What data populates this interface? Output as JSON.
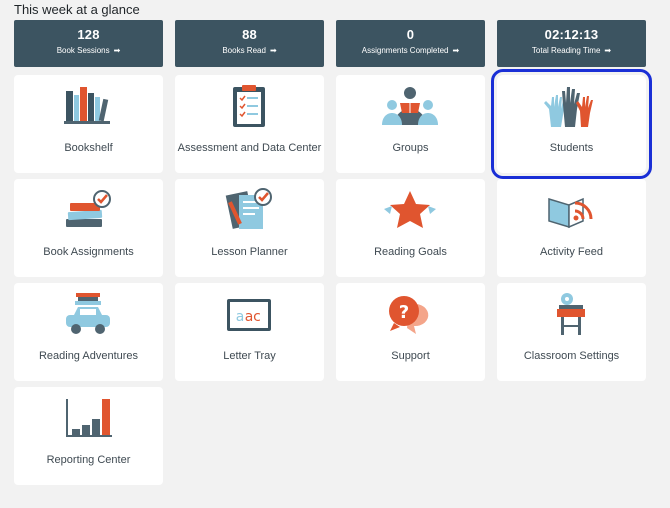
{
  "heading": "This week at a glance",
  "stats": [
    {
      "value": "128",
      "label": "Book Sessions",
      "arrow": "➡"
    },
    {
      "value": "88",
      "label": "Books Read",
      "arrow": "➡"
    },
    {
      "value": "0",
      "label": "Assignments Completed",
      "arrow": "➡"
    },
    {
      "value": "02:12:13",
      "label": "Total Reading Time",
      "arrow": "➡"
    }
  ],
  "tiles": [
    {
      "label": "Bookshelf",
      "icon": "bookshelf-icon"
    },
    {
      "label": "Assessment and Data Center",
      "icon": "clipboard-checklist-icon"
    },
    {
      "label": "Groups",
      "icon": "group-reading-icon"
    },
    {
      "label": "Students",
      "icon": "raised-hands-icon",
      "selected": true
    },
    {
      "label": "Book Assignments",
      "icon": "book-stack-check-icon"
    },
    {
      "label": "Lesson Planner",
      "icon": "lesson-planner-icon"
    },
    {
      "label": "Reading Goals",
      "icon": "star-icon"
    },
    {
      "label": "Activity Feed",
      "icon": "book-feed-icon"
    },
    {
      "label": "Reading Adventures",
      "icon": "car-books-icon"
    },
    {
      "label": "Letter Tray",
      "icon": "abc-board-icon"
    },
    {
      "label": "Support",
      "icon": "question-bubble-icon"
    },
    {
      "label": "Classroom Settings",
      "icon": "desk-gear-icon"
    },
    {
      "label": "Reporting Center",
      "icon": "bar-chart-icon"
    }
  ],
  "colors": {
    "stat_bg": "#3c5461",
    "accent_orange": "#e0552f",
    "slate": "#4f6470",
    "light_blue": "#8fc9e0",
    "selection": "#1a2fd6"
  }
}
